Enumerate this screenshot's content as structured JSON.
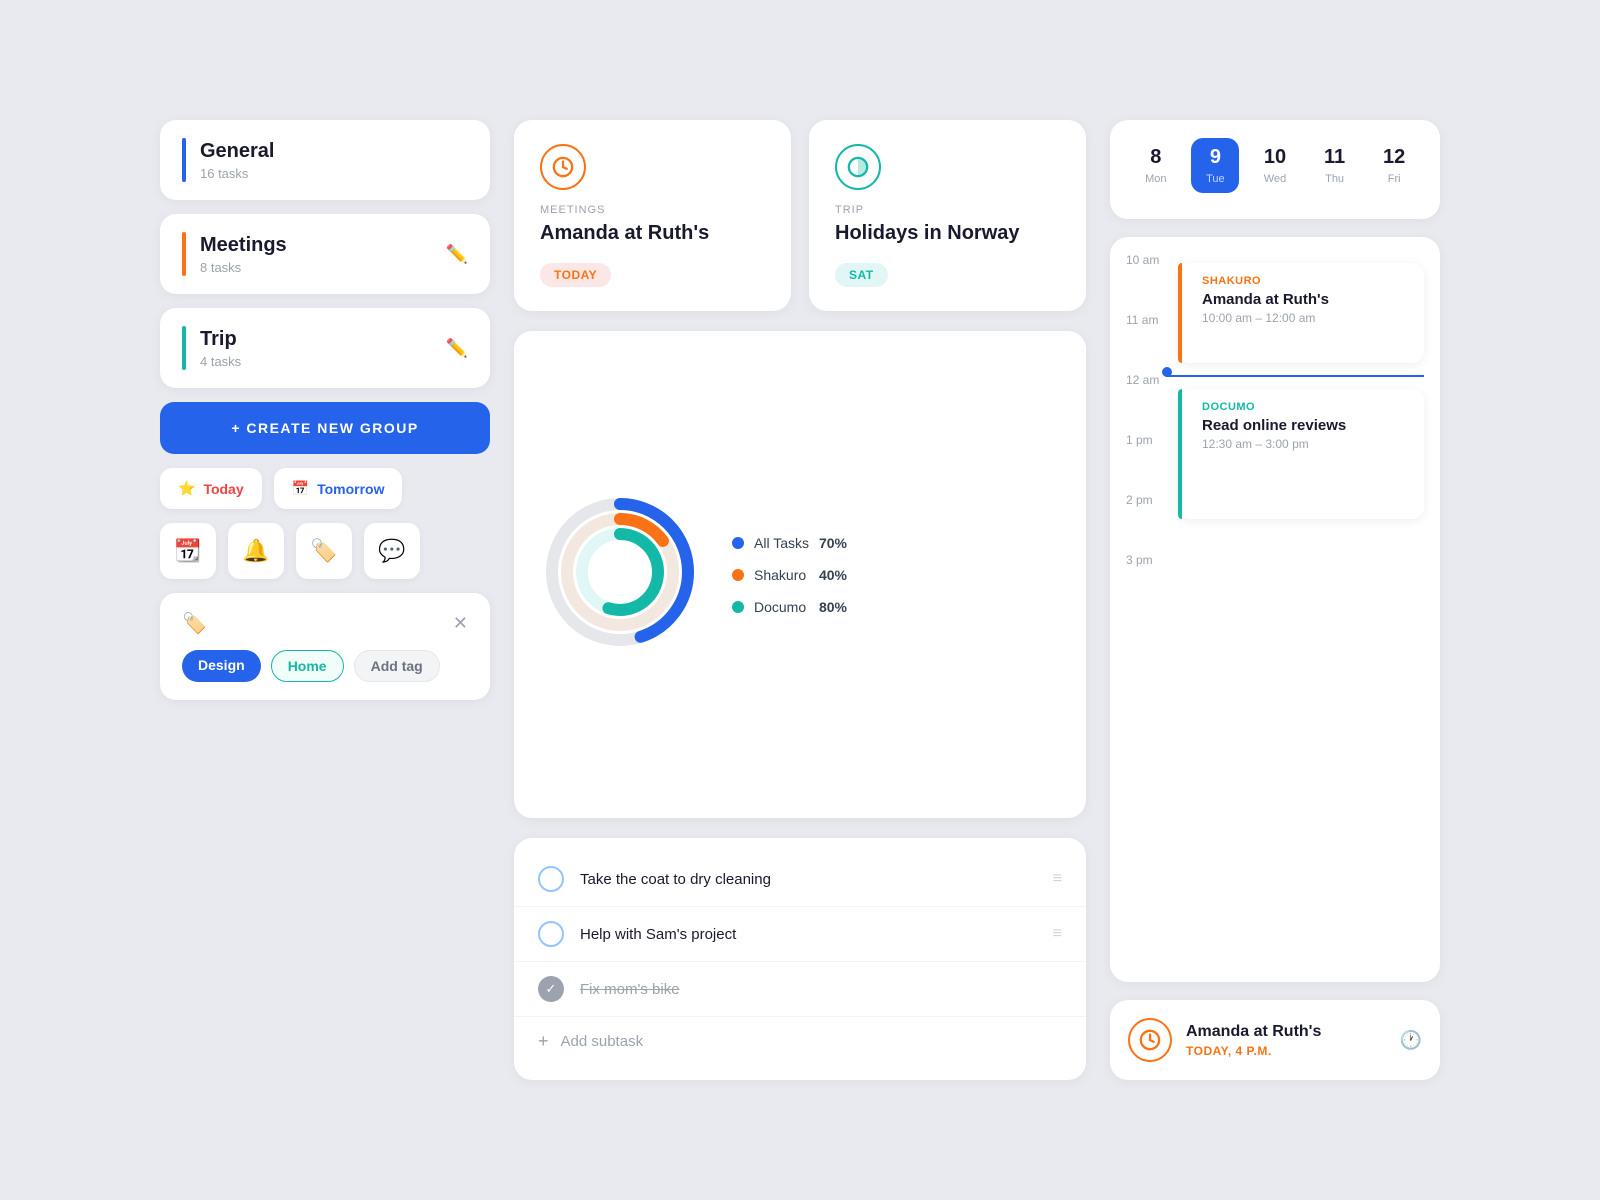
{
  "left": {
    "groups": [
      {
        "id": "general",
        "name": "General",
        "tasks": "16 tasks",
        "bar": "bar-blue"
      },
      {
        "id": "meetings",
        "name": "Meetings",
        "tasks": "8 tasks",
        "bar": "bar-orange"
      },
      {
        "id": "trip",
        "name": "Trip",
        "tasks": "4 tasks",
        "bar": "bar-teal"
      }
    ],
    "create_label": "+ CREATE NEW GROUP",
    "filter_today": "Today",
    "filter_tomorrow": "Tomorrow",
    "tags": {
      "tag1": "Design",
      "tag2": "Home",
      "tag3": "Add tag"
    }
  },
  "middle": {
    "event1": {
      "category": "MEETINGS",
      "title": "Amanda at Ruth's",
      "badge": "TODAY"
    },
    "event2": {
      "category": "TRIP",
      "title": "Holidays in Norway",
      "badge": "SAT"
    },
    "chart": {
      "legend": [
        {
          "label": "All Tasks",
          "pct": "70%",
          "dot": "dot-blue"
        },
        {
          "label": "Shakuro",
          "pct": "40%",
          "dot": "dot-orange"
        },
        {
          "label": "Documo",
          "pct": "80%",
          "dot": "dot-teal"
        }
      ]
    },
    "tasks": [
      {
        "id": "t1",
        "text": "Take the coat to dry cleaning",
        "done": false
      },
      {
        "id": "t2",
        "text": "Help with Sam's project",
        "done": false
      },
      {
        "id": "t3",
        "text": "Fix mom's bike",
        "done": true
      }
    ],
    "add_subtask_label": "Add subtask"
  },
  "right": {
    "calendar": {
      "days": [
        {
          "num": "8",
          "label": "Mon",
          "active": false
        },
        {
          "num": "9",
          "label": "Tue",
          "active": true
        },
        {
          "num": "10",
          "label": "Wed",
          "active": false
        },
        {
          "num": "11",
          "label": "Thu",
          "active": false
        },
        {
          "num": "12",
          "label": "Fri",
          "active": false
        }
      ]
    },
    "timeline": {
      "time1": "10 am",
      "time2": "11 am",
      "time3": "12 am",
      "time4": "1 pm",
      "time5": "2 pm",
      "time6": "3 pm",
      "event1": {
        "company": "SHAKURO",
        "title": "Amanda at Ruth's",
        "time": "10:00 am – 12:00 am"
      },
      "event2": {
        "company": "DOCUMO",
        "title": "Read online reviews",
        "time": "12:30 am – 3:00 pm"
      }
    },
    "bottom_event": {
      "title": "Amanda at Ruth's",
      "time": "TODAY, 4 P.M."
    }
  }
}
